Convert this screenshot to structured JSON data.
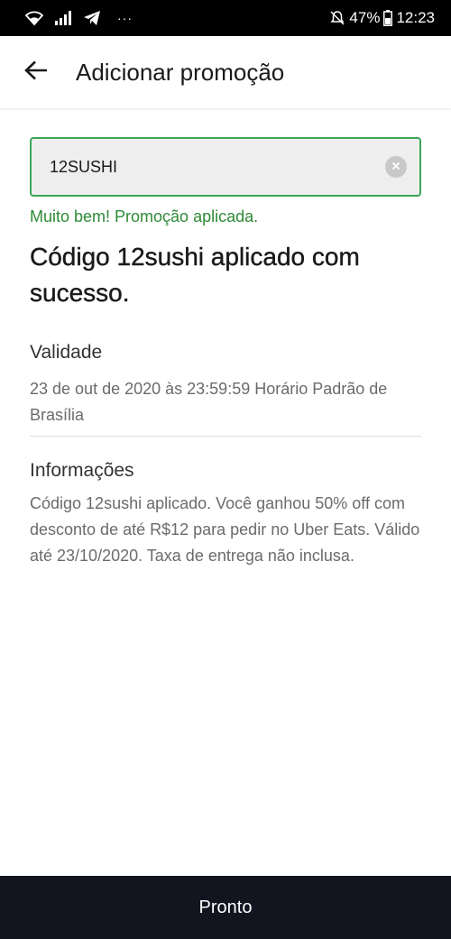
{
  "status_bar": {
    "icons": [
      "wifi-icon",
      "signal-icon",
      "telegram-icon"
    ],
    "more": "···",
    "mute_icon": "mute-icon",
    "battery_percent": "47%",
    "time": "12:23"
  },
  "app_bar": {
    "back_icon": "arrow-left-icon",
    "title": "Adicionar promoção"
  },
  "promo": {
    "value": "12SUSHI",
    "clear_icon": "clear-icon",
    "success_message": "Muito bem! Promoção aplicada."
  },
  "result": {
    "heading": "Código 12sushi aplicado com sucesso."
  },
  "validity": {
    "label": "Validade",
    "text": "23 de out de 2020 às 23:59:59 Horário Padrão de Brasília"
  },
  "info": {
    "label": "Informações",
    "text": "Código 12sushi aplicado. Você ganhou 50% off com desconto de até R$12 para pedir no Uber Eats. Válido até 23/10/2020. Taxa de entrega não inclusa."
  },
  "footer": {
    "done_label": "Pronto"
  },
  "colors": {
    "success": "#2e8a36",
    "field_border": "#3aa757",
    "field_bg": "#eeeeee",
    "button_bg": "#121420",
    "status_bar_bg": "#000000"
  }
}
